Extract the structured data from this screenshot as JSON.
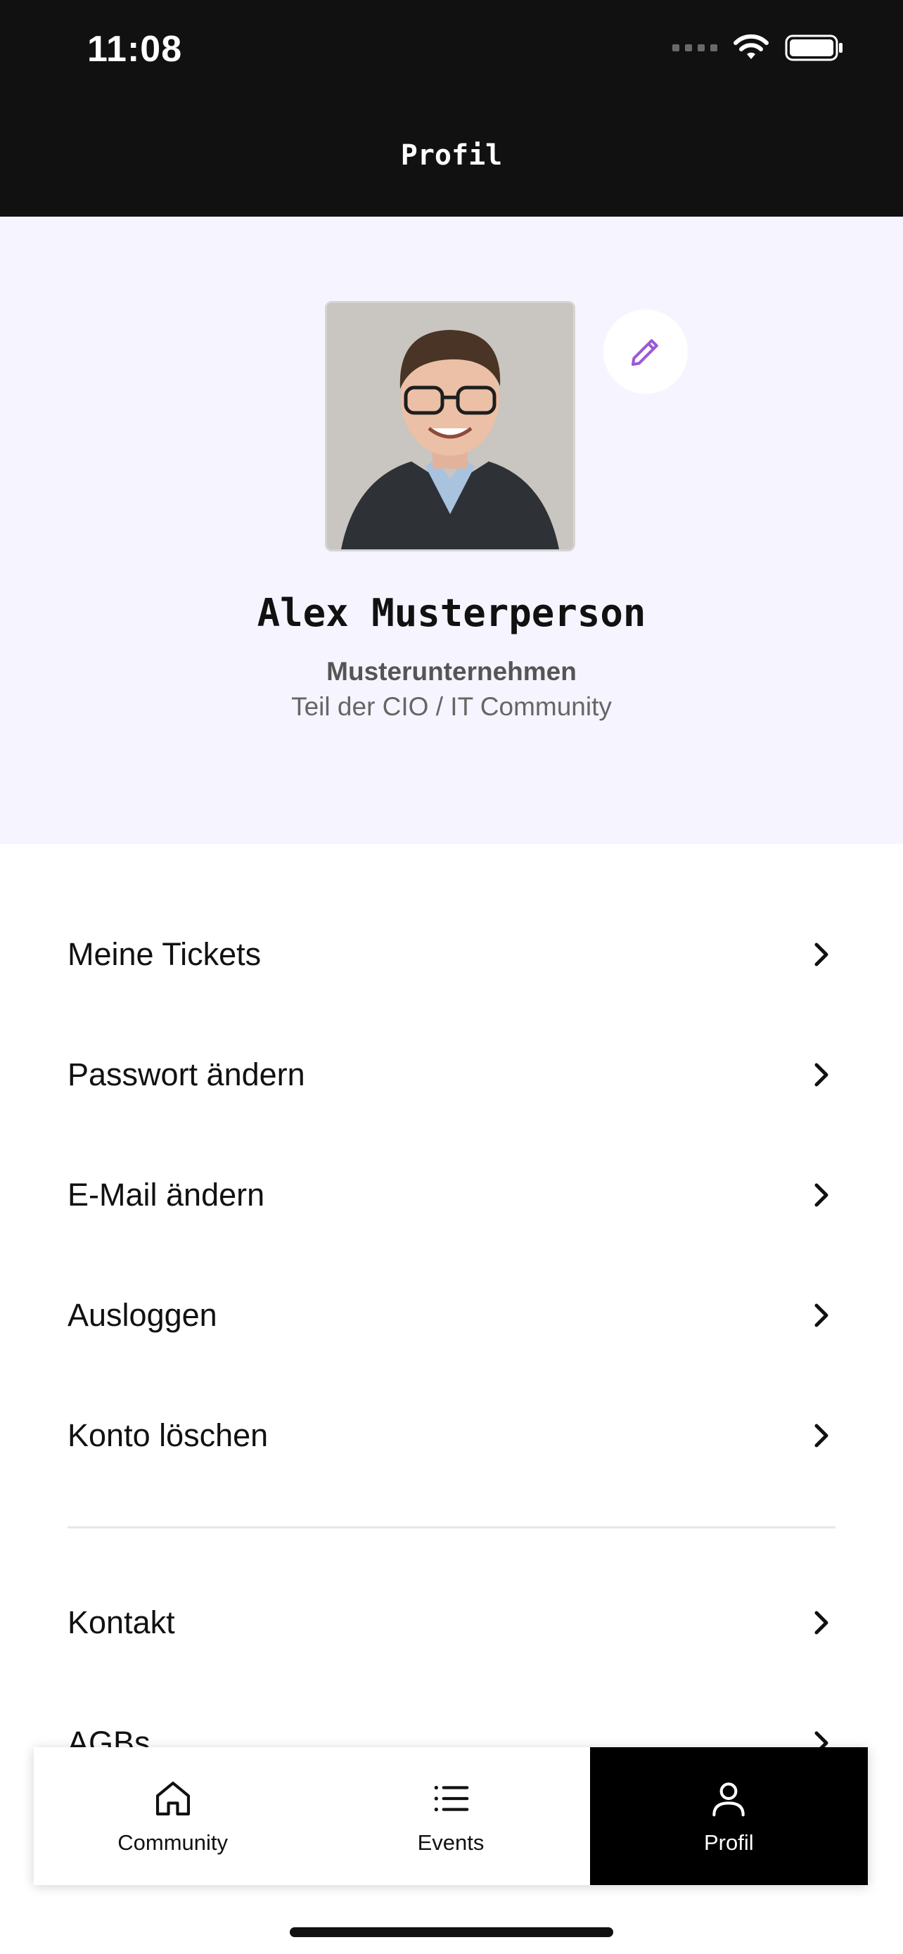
{
  "status_bar": {
    "time": "11:08"
  },
  "header": {
    "title": "Profil"
  },
  "profile": {
    "name": "Alex Musterperson",
    "company": "Musterunternehmen",
    "community": "Teil der CIO / IT Community"
  },
  "menu": {
    "items": [
      {
        "label": "Meine Tickets"
      },
      {
        "label": "Passwort ändern"
      },
      {
        "label": "E-Mail ändern"
      },
      {
        "label": "Ausloggen"
      },
      {
        "label": "Konto löschen"
      }
    ],
    "secondary": [
      {
        "label": "Kontakt"
      },
      {
        "label": "AGBs"
      }
    ]
  },
  "bottom_nav": {
    "tabs": [
      {
        "label": "Community",
        "icon": "home-icon"
      },
      {
        "label": "Events",
        "icon": "list-icon"
      },
      {
        "label": "Profil",
        "icon": "person-icon",
        "active": true
      }
    ]
  },
  "colors": {
    "header_bg": "#111111",
    "profile_bg": "#f6f4fe",
    "accent": "#9b59d6",
    "active_tab_bg": "#000000"
  }
}
